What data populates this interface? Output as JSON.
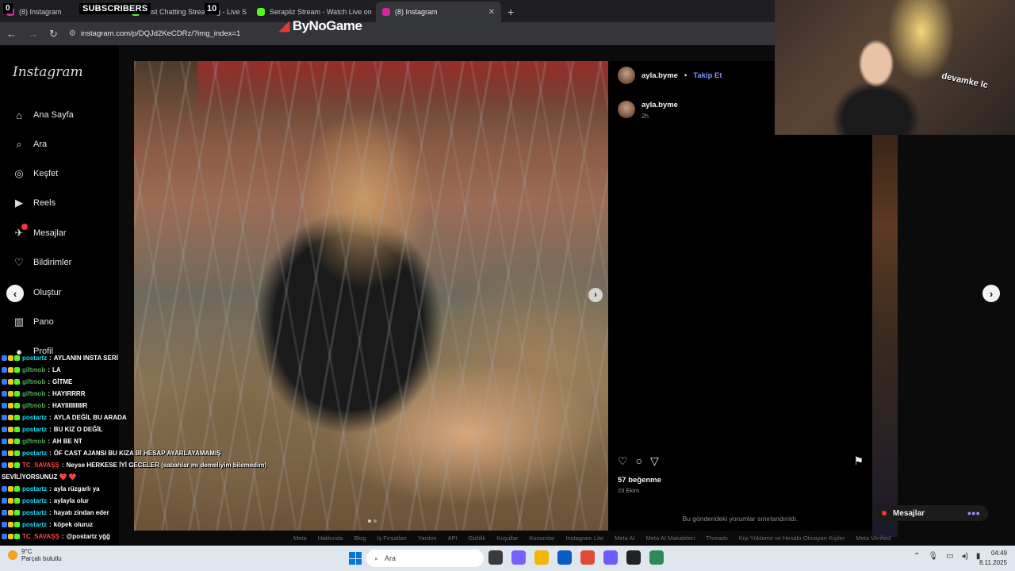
{
  "browser": {
    "tabs": [
      {
        "label": "(8) Instagram",
        "icon": "instagram-icon",
        "color": "#d6249f",
        "active": false
      },
      {
        "label": "Just Chatting Streaming - Live S",
        "icon": "kick-icon",
        "color": "#53fc18",
        "active": false
      },
      {
        "label": "Serapiiz Stream - Watch Live on",
        "icon": "kick-icon",
        "color": "#53fc18",
        "active": false
      },
      {
        "label": "(8) Instagram",
        "icon": "instagram-icon",
        "color": "#d6249f",
        "active": true
      }
    ],
    "url": "instagram.com/p/DQJd2KeCDRz/?img_index=1"
  },
  "stream_overlay": {
    "subscribers_label": "SUBSCRIBERS",
    "subscribers_count": "10",
    "zero_badge": "0",
    "brand": "ByNoGame",
    "webcam_text": "devamke lc"
  },
  "instagram": {
    "logo": "Instagram",
    "nav": [
      {
        "label": "Ana Sayfa",
        "icon": "home-icon",
        "glyph": "⌂"
      },
      {
        "label": "Ara",
        "icon": "search-icon",
        "glyph": "⌕"
      },
      {
        "label": "Keşfet",
        "icon": "explore-icon",
        "glyph": "◎"
      },
      {
        "label": "Reels",
        "icon": "reels-icon",
        "glyph": "▶"
      },
      {
        "label": "Mesajlar",
        "icon": "messages-icon",
        "glyph": "✈"
      },
      {
        "label": "Bildirimler",
        "icon": "heart-icon",
        "glyph": "♡"
      },
      {
        "label": "Oluştur",
        "icon": "create-icon",
        "glyph": "⊕"
      },
      {
        "label": "Pano",
        "icon": "dashboard-icon",
        "glyph": "▥"
      },
      {
        "label": "Profil",
        "icon": "profile-icon",
        "glyph": "●"
      }
    ],
    "post": {
      "username": "ayla.byme",
      "follow_label": "Takip Et",
      "caption_user": "ayla.byme",
      "caption_time": "2h",
      "likes": "57 beğenme",
      "date": "23 Ekim",
      "comments_note": "Bu gönderideki yorumlar sınırlandırıldı."
    },
    "messages_float": "Mesajlar",
    "footer": [
      "Meta",
      "Hakkında",
      "Blog",
      "İş Fırsatları",
      "Yardım",
      "API",
      "Gizlilik",
      "Koşullar",
      "Konumlar",
      "Instagram Lite",
      "Meta AI",
      "Meta AI Makaleleri",
      "Threads",
      "Kişi Yükleme ve Hesabı Olmayan Kişiler",
      "Meta Verified"
    ]
  },
  "chat": [
    {
      "user": "postartz",
      "msg": "AYLANIN INSTA SERİ",
      "color": "#00e5ff"
    },
    {
      "user": "giftmob",
      "msg": "LA",
      "color": "#4caf50"
    },
    {
      "user": "giftmob",
      "msg": "GİTME",
      "color": "#4caf50"
    },
    {
      "user": "giftmob",
      "msg": "HAYIRRRR",
      "color": "#4caf50"
    },
    {
      "user": "giftmob",
      "msg": "HAYIIIIIIIIIIR",
      "color": "#4caf50"
    },
    {
      "user": "postartz",
      "msg": "AYLA DEĞİL BU ARADA",
      "color": "#00e5ff"
    },
    {
      "user": "postartz",
      "msg": "BU KIZ O DEĞİL",
      "color": "#00e5ff"
    },
    {
      "user": "giftmob",
      "msg": "AH BE NT",
      "color": "#4caf50"
    },
    {
      "user": "postartz",
      "msg": "ÖF CAST AJANSI BU KIZA Bİ HESAP AYARLAYAMAMIŞ",
      "color": "#00e5ff"
    },
    {
      "user": "TC_SAVAŞŞ",
      "msg": "Neyse HERKESE İYİ GECELER (sabahlar mı demeliyim bilemedim)",
      "color": "#ff4444"
    },
    {
      "user": "",
      "msg": "SEVİLİYORSUNUZ ❤️ ❤️",
      "color": "#ffffff"
    },
    {
      "user": "postartz",
      "msg": "ayla rüzgarlı ya",
      "color": "#00e5ff"
    },
    {
      "user": "postartz",
      "msg": "aylayla olur",
      "color": "#00e5ff"
    },
    {
      "user": "postartz",
      "msg": "hayatı zindan eder",
      "color": "#00e5ff"
    },
    {
      "user": "postartz",
      "msg": "köpek oluruz",
      "color": "#00e5ff"
    },
    {
      "user": "TC_SAVAŞŞ",
      "msg": "@postartz yğğ",
      "color": "#ff4444"
    }
  ],
  "taskbar": {
    "weather_temp": "9°C",
    "weather_desc": "Parçalı bulutlu",
    "search_placeholder": "Ara",
    "apps": [
      "#3a3a3a",
      "#7b61ff",
      "#f2b600",
      "#0a5cc4",
      "#dd4b39",
      "#6b5cff",
      "#222222",
      "#2e8b57"
    ],
    "time": "04:49",
    "date": "8.11.2025"
  }
}
